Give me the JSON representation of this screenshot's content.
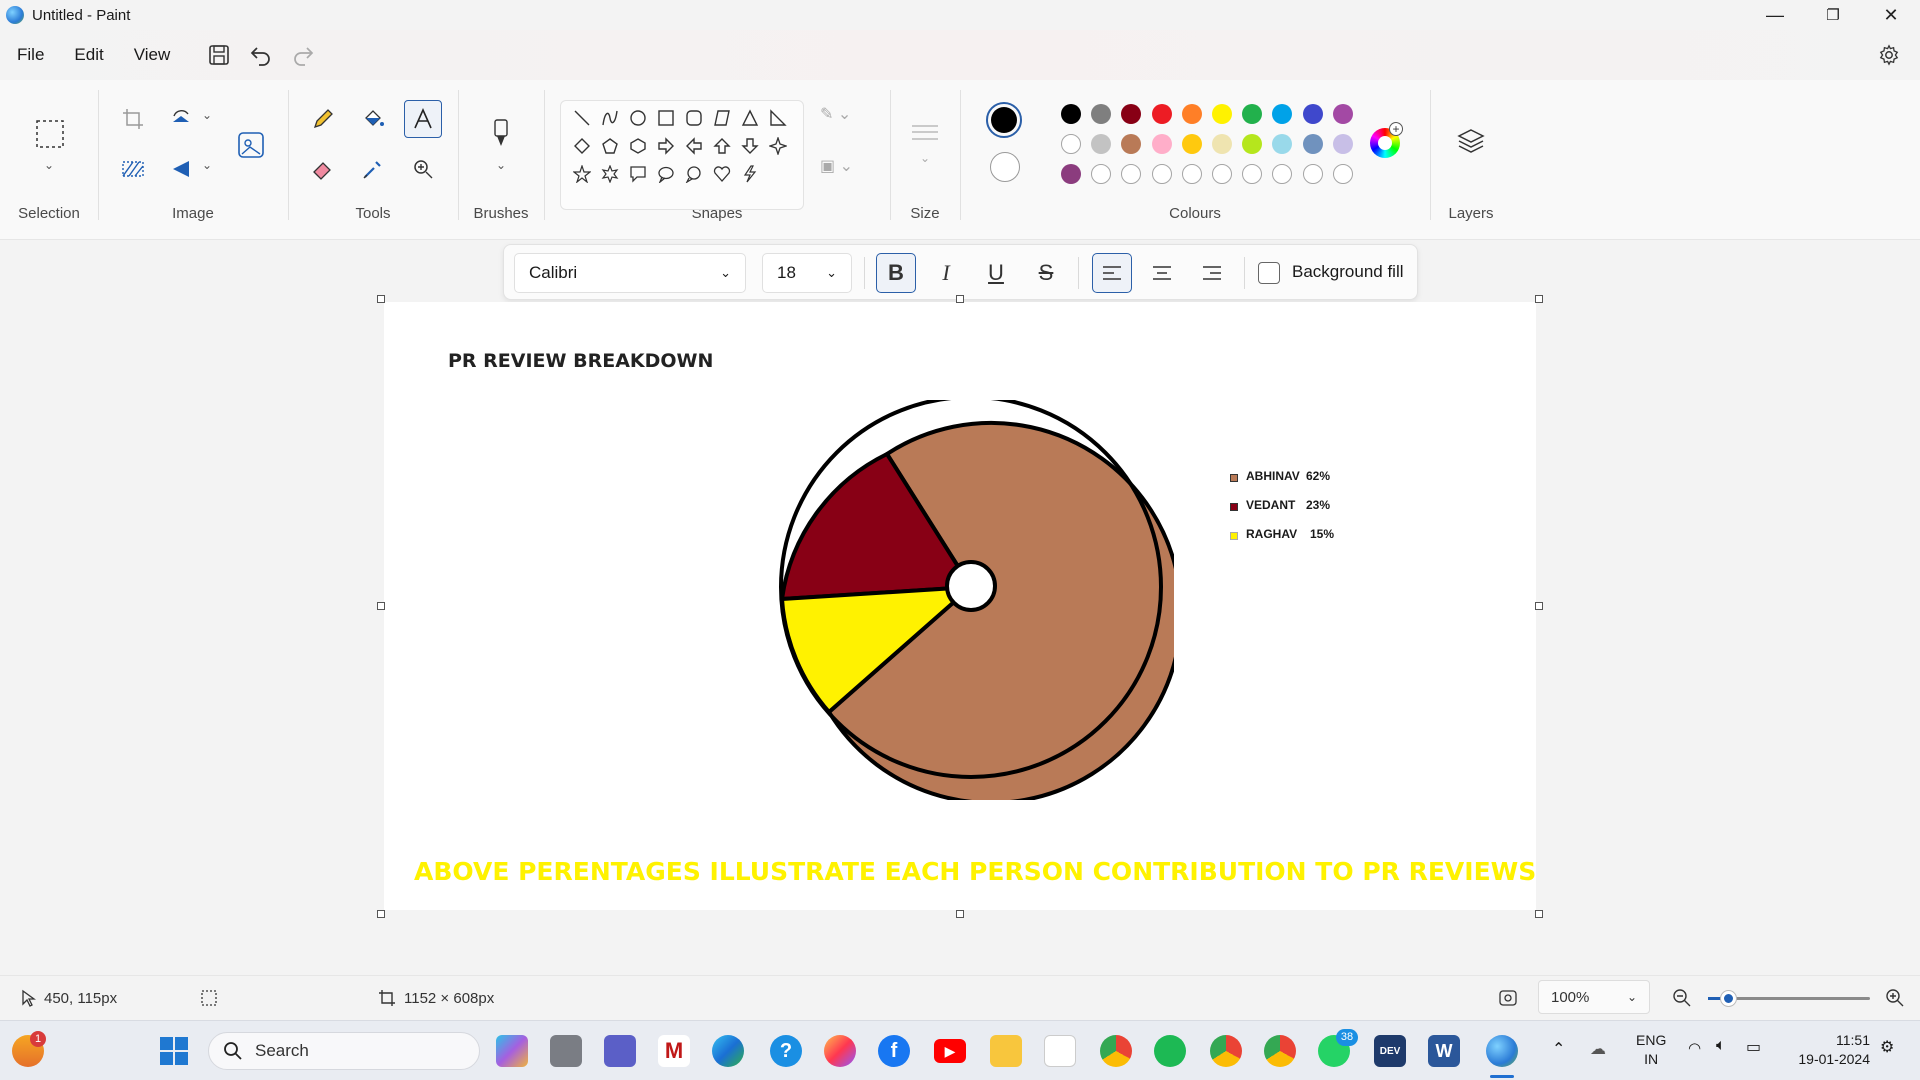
{
  "window": {
    "title": "Untitled - Paint",
    "minimize": "—",
    "maximize": "❐",
    "close": "✕"
  },
  "menu": {
    "file": "File",
    "edit": "Edit",
    "view": "View"
  },
  "ribbon": {
    "groups": {
      "selection": "Selection",
      "image": "Image",
      "tools": "Tools",
      "brushes": "Brushes",
      "shapes": "Shapes",
      "size": "Size",
      "colours": "Colours",
      "layers": "Layers"
    },
    "palette_row1": [
      "#000000",
      "#7f7f7f",
      "#880015",
      "#ed1c24",
      "#ff7f27",
      "#fff200",
      "#22b14c",
      "#00a2e8",
      "#3f48cc",
      "#a349a4"
    ],
    "palette_row2": [
      "#ffffff",
      "#c3c3c3",
      "#b97a57",
      "#ffaec9",
      "#ffc90e",
      "#efe4b0",
      "#b5e61d",
      "#99d9ea",
      "#7092be",
      "#c8bfe7"
    ],
    "palette_row3": [
      "#8b3c7e"
    ],
    "primary_color": "#000000",
    "secondary_color": "#ffffff"
  },
  "textbar": {
    "font": "Calibri",
    "size": "18",
    "bold": "B",
    "italic": "I",
    "underline": "U",
    "strike": "S",
    "background_fill": "Background fill"
  },
  "canvas": {
    "heading": "PR REVIEW BREAKDOWN",
    "footer": "ABOVE PERENTAGES ILLUSTRATE EACH PERSON CONTRIBUTION TO PR REVIEWS",
    "footer_color": "#fff200",
    "legend": [
      {
        "name": "ABHINAV",
        "pct": "62%",
        "color": "#b97a57"
      },
      {
        "name": "VEDANT",
        "pct": "23%",
        "color": "#880015"
      },
      {
        "name": "RAGHAV",
        "pct": "15%",
        "color": "#fff200"
      }
    ]
  },
  "status": {
    "cursor": "450, 115px",
    "canvas_size": "1152 × 608px",
    "zoom": "100%"
  },
  "taskbar": {
    "search": "Search",
    "lang1": "ENG",
    "lang2": "IN",
    "time": "11:51",
    "date": "19-01-2024",
    "badge_weather": "1",
    "badge_whatsapp": "38"
  }
}
